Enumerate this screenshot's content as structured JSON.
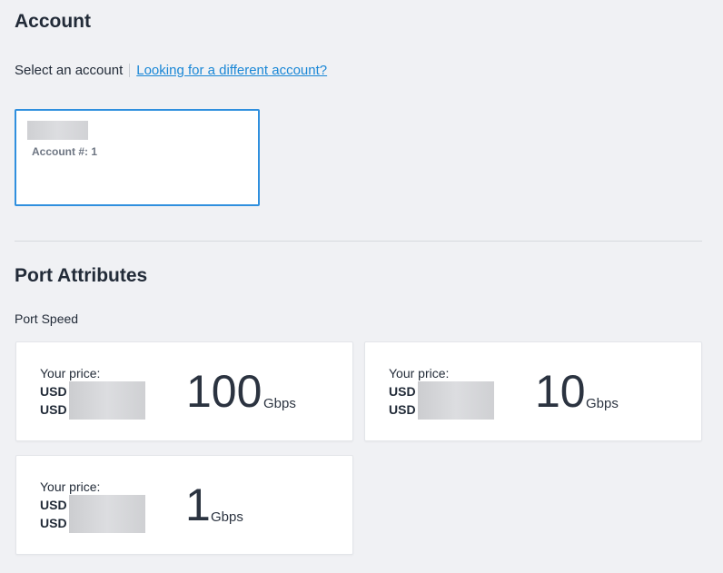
{
  "account": {
    "title": "Account",
    "select_label": "Select an account",
    "different_link": "Looking for a different account?",
    "card": {
      "number_label": "Account #: 1"
    }
  },
  "port": {
    "title": "Port Attributes",
    "speed_label": "Port Speed",
    "options": [
      {
        "price_label": "Your price:",
        "currency1": "USD",
        "currency2": "USD",
        "speed": "100",
        "unit": "Gbps"
      },
      {
        "price_label": "Your price:",
        "currency1": "USD",
        "currency2": "USD",
        "speed": "10",
        "unit": "Gbps"
      },
      {
        "price_label": "Your price:",
        "currency1": "USD",
        "currency2": "USD",
        "speed": "1",
        "unit": "Gbps"
      }
    ]
  },
  "colors": {
    "background": "#f0f1f4",
    "accent": "#2f8fde",
    "link": "#1a87d6",
    "text": "#222b38"
  }
}
